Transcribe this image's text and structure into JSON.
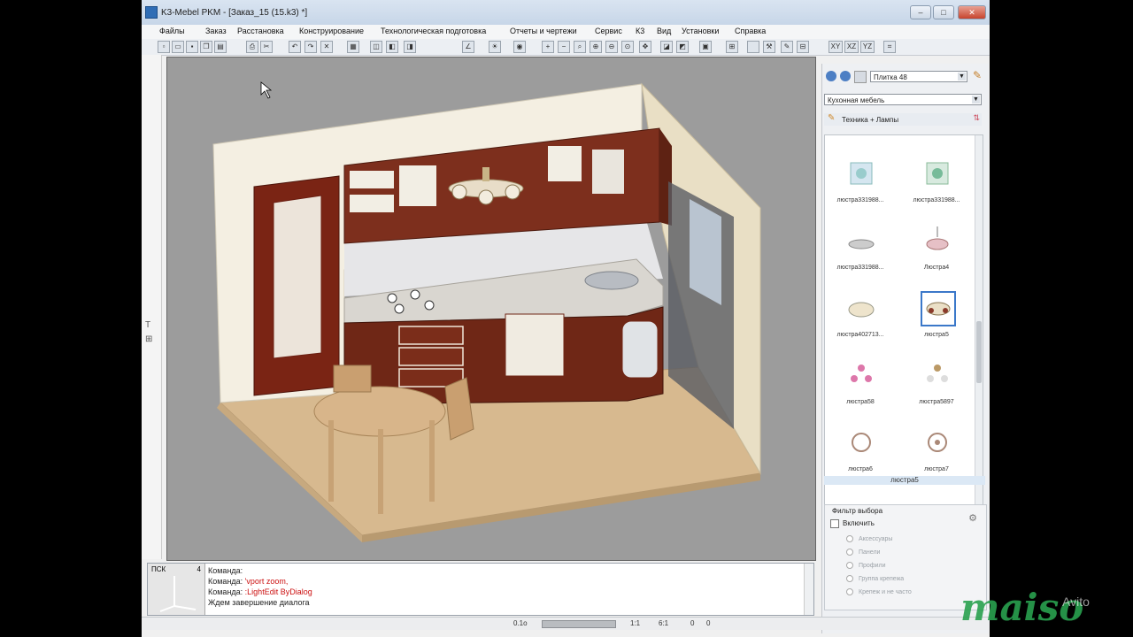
{
  "window": {
    "title": "K3-Mebel PKM - [Заказ_15 (15.k3) *]",
    "btn_min": "–",
    "btn_max": "□",
    "btn_close": "✕"
  },
  "menu": [
    "Файлы",
    "Заказ",
    "Расстановка",
    "Конструирование",
    "Технологическая подготовка",
    "Отчеты и чертежи",
    "Сервис",
    "К3",
    "Вид",
    "Установки",
    "Справка"
  ],
  "view_tabs": [
    "XY",
    "XZ",
    "YZ"
  ],
  "right_panel": {
    "texture_combo": "Плитка 48",
    "category_combo": "Кухонная мебель",
    "breadcrumb": "Техника + Лампы",
    "items": [
      {
        "label": "люстра331988..."
      },
      {
        "label": "люстра331988..."
      },
      {
        "label": "люстра331988..."
      },
      {
        "label": "Люстра4"
      },
      {
        "label": "люстра402713..."
      },
      {
        "label": "люстра5"
      },
      {
        "label": "люстра58"
      },
      {
        "label": "люстра5897"
      },
      {
        "label": "люстра6"
      },
      {
        "label": "люстра7"
      }
    ],
    "selected_label": "люстра5",
    "filter": {
      "title": "Фильтр выбора",
      "enable_label": "Включить",
      "options": [
        "Аксессуары",
        "Панели",
        "Профили",
        "Группа крепежа",
        "Крепеж и не часто"
      ]
    }
  },
  "command_area": {
    "ucs_label": "ПСК",
    "ucs_num": "4",
    "lines": [
      {
        "prefix": "Команда:",
        "cmd": ""
      },
      {
        "prefix": "Команда: ",
        "cmd": "'vport zoom,"
      },
      {
        "prefix": "Команда: ",
        "cmd": ":LightEdit ByDialog"
      },
      {
        "prefix": "Ждем завершение диалога",
        "cmd": ""
      }
    ]
  },
  "statusbar": {
    "scale": "0.1o",
    "v1": "1:1",
    "v2": "6:1",
    "v3": "0",
    "v4": "0"
  },
  "watermark": {
    "text": "maiso",
    "sub": "Avito"
  }
}
